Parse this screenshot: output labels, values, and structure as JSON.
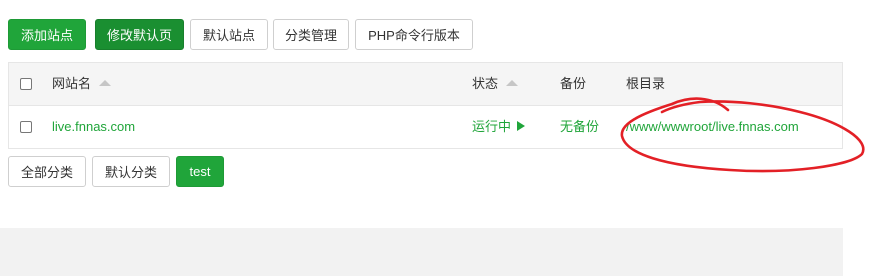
{
  "toolbar": {
    "add_site": "添加站点",
    "edit_default_page": "修改默认页",
    "default_site": "默认站点",
    "category_manage": "分类管理",
    "php_cli_version": "PHP命令行版本"
  },
  "table": {
    "headers": {
      "site_name": "网站名",
      "status": "状态",
      "backup": "备份",
      "root_dir": "根目录"
    },
    "rows": [
      {
        "name": "live.fnnas.com",
        "status": "运行中",
        "backup": "无备份",
        "root": "/www/wwwroot/live.fnnas.com"
      }
    ]
  },
  "categories": {
    "all": "全部分类",
    "default": "默认分类",
    "test": "test"
  },
  "colors": {
    "accent": "#20a53a",
    "annotation": "#e32026"
  }
}
